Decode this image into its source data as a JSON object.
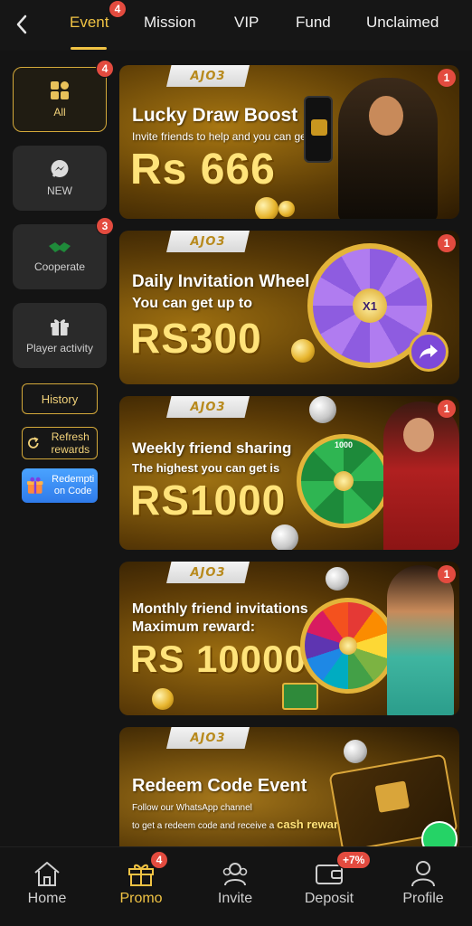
{
  "header": {
    "tabs": [
      {
        "label": "Event",
        "badge": "4",
        "active": true
      },
      {
        "label": "Mission"
      },
      {
        "label": "VIP"
      },
      {
        "label": "Fund"
      },
      {
        "label": "Unclaimed"
      }
    ]
  },
  "sidebar": {
    "categories": [
      {
        "label": "All",
        "badge": "4",
        "icon": "grid-icon",
        "active": true
      },
      {
        "label": "NEW",
        "icon": "messenger-icon"
      },
      {
        "label": "Cooperate",
        "badge": "3",
        "icon": "handshake-icon"
      },
      {
        "label": "Player activity",
        "icon": "gift-icon"
      }
    ],
    "history_label": "History",
    "refresh_label": "Refresh rewards",
    "redeem_label": "Redempti on Code"
  },
  "banners": [
    {
      "logo": "AJO3",
      "title": "Lucky Draw Boost",
      "subtitle": "Invite friends to help and you can get",
      "amount": "Rs 666",
      "badge": "1"
    },
    {
      "logo": "AJO3",
      "title": "Daily Invitation Wheel",
      "subtitle": "You can get up to",
      "amount": "RS300",
      "badge": "1",
      "wheel_center": "X1"
    },
    {
      "logo": "AJO3",
      "title": "Weekly friend sharing",
      "subtitle": "The highest you can get is",
      "amount": "RS1000",
      "badge": "1",
      "wheel_top": "1000"
    },
    {
      "logo": "AJO3",
      "title": "Monthly friend invitations",
      "subtitle": "Maximum reward:",
      "amount": "RS 10000",
      "badge": "1"
    },
    {
      "logo": "AJO3",
      "title": "Redeem Code Event",
      "subtitle": "Follow our WhatsApp channel",
      "subtitle2": "to get a redeem code and receive a",
      "highlight": "cash reward!"
    }
  ],
  "bottom_nav": [
    {
      "label": "Home",
      "icon": "home-icon"
    },
    {
      "label": "Promo",
      "icon": "gift-icon",
      "badge": "4",
      "active": true
    },
    {
      "label": "Invite",
      "icon": "people-icon"
    },
    {
      "label": "Deposit",
      "icon": "wallet-icon",
      "badge": "+7%"
    },
    {
      "label": "Profile",
      "icon": "user-icon"
    }
  ],
  "colors": {
    "accent": "#f0c344",
    "badge": "#e34b3f",
    "background": "#141414",
    "card": "#2a2a2a"
  }
}
